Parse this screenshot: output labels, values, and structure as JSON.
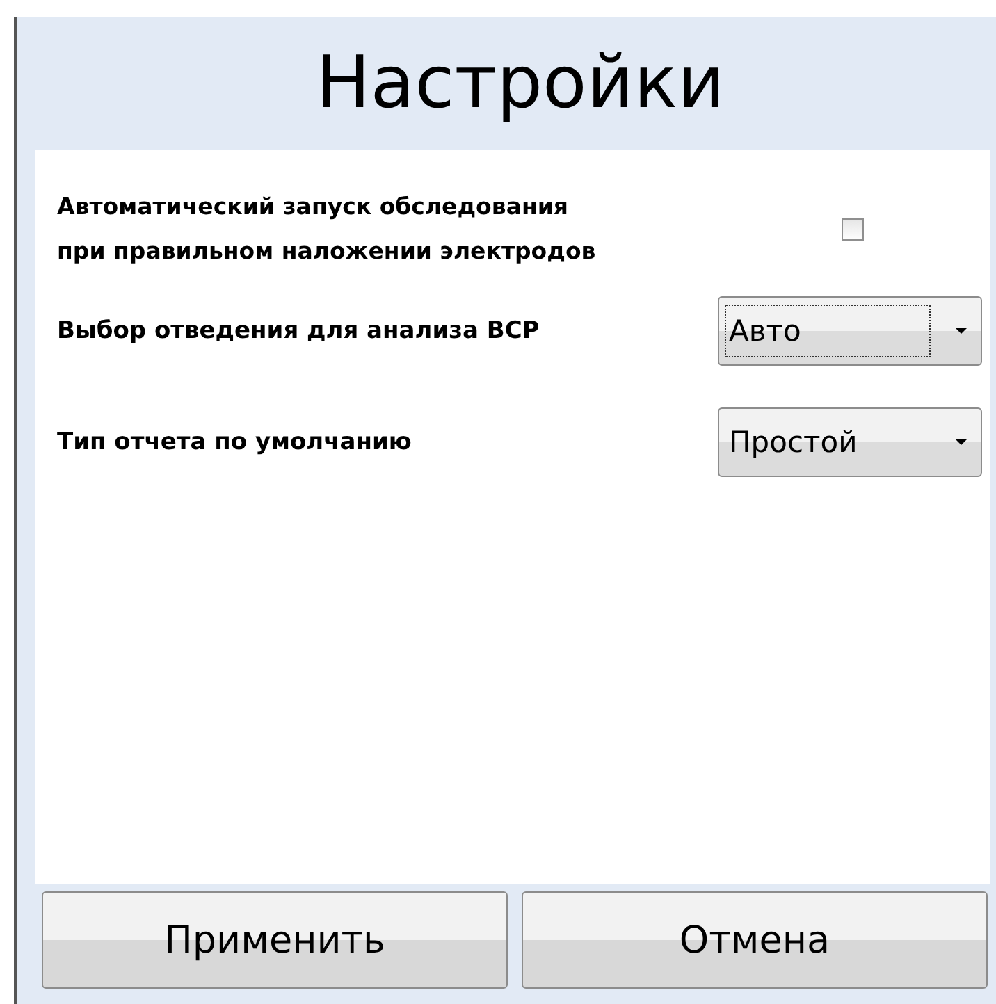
{
  "title": "Настройки",
  "settings": [
    {
      "kind": "checkbox",
      "label": "Автоматический запуск обследования\nпри правильном наложении электродов",
      "checked": false
    },
    {
      "kind": "dropdown",
      "label": "Выбор отведения для анализа ВСР",
      "value": "Авто",
      "focused": true
    },
    {
      "kind": "dropdown",
      "label": "Тип отчета по умолчанию",
      "value": "Простой",
      "focused": false
    }
  ],
  "buttons": [
    "Применить",
    "Отмена"
  ]
}
